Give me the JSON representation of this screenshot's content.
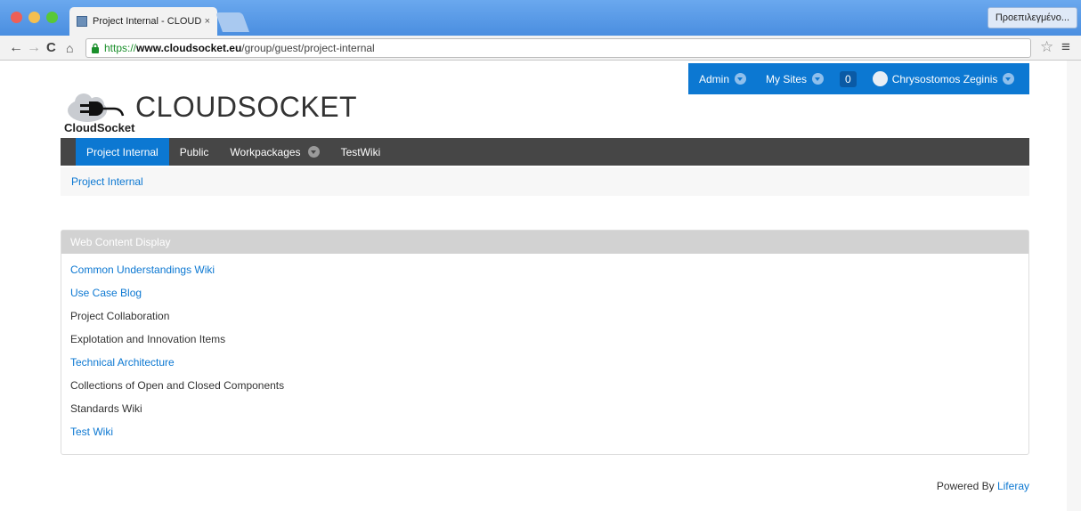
{
  "browser": {
    "tab_title": "Project Internal - CLOUDSC",
    "tab_close": "×",
    "profile_label": "Προεπιλεγμένο...",
    "url_scheme": "https://",
    "url_host": "www.cloudsocket.eu",
    "url_path": "/group/guest/project-internal"
  },
  "dockbar": {
    "admin_label": "Admin",
    "my_sites_label": "My Sites",
    "notification_count": "0",
    "user_name": "Chrysostomos Zeginis"
  },
  "logo": {
    "sub_text": "CloudSocket",
    "site_name": "CLOUDSOCKET"
  },
  "nav": {
    "items": [
      {
        "label": "Project Internal"
      },
      {
        "label": "Public"
      },
      {
        "label": "Workpackages"
      },
      {
        "label": "TestWiki"
      }
    ]
  },
  "breadcrumb": {
    "current": "Project Internal"
  },
  "portlet": {
    "title": "Web Content Display",
    "items": [
      {
        "label": "Common Understandings Wiki",
        "link": true
      },
      {
        "label": "Use Case Blog",
        "link": true
      },
      {
        "label": "Project Collaboration",
        "link": false
      },
      {
        "label": "Explotation and Innovation Items",
        "link": false
      },
      {
        "label": "Technical Architecture",
        "link": true
      },
      {
        "label": "Collections of Open and Closed Components",
        "link": false
      },
      {
        "label": "Standards Wiki",
        "link": false
      },
      {
        "label": "Test Wiki",
        "link": true
      }
    ]
  },
  "footer": {
    "prefix": "Powered By",
    "link": "Liferay"
  },
  "colors": {
    "accent": "#0c78d2",
    "navbar": "#464646",
    "portlet_header": "#d2d2d2"
  }
}
